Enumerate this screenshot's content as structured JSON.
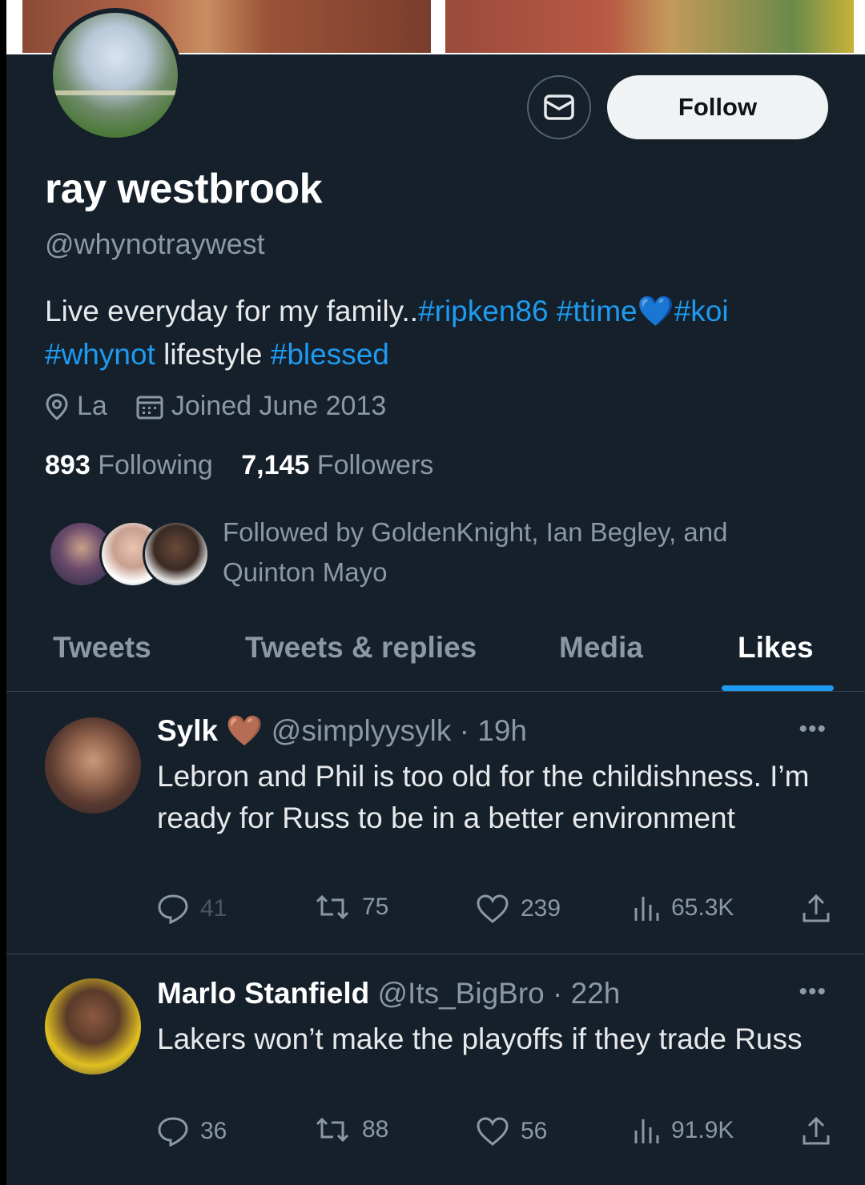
{
  "profile": {
    "name": "ray westbrook",
    "handle": "@whynotraywest",
    "bio_text_1": "Live everyday for my family..",
    "bio_tag_1": "#ripken86",
    "bio_tag_2": "#ttime",
    "bio_emoji": "💙",
    "bio_tag_3": "#koi",
    "bio_tag_4": "#whynot",
    "bio_text_2": "lifestyle",
    "bio_tag_5": "#blessed",
    "location": "La",
    "joined": "Joined June 2013",
    "following_count": "893",
    "following_label": "Following",
    "followers_count": "7,145",
    "followers_label": "Followers",
    "followed_by": "Followed by GoldenKnight, Ian Begley, and Quinton Mayo",
    "follow_label": "Follow"
  },
  "tabs": [
    "Tweets",
    "Tweets & replies",
    "Media",
    "Likes"
  ],
  "active_tab": "Likes",
  "tweets": [
    {
      "name": "Sylk",
      "badge": "🤎",
      "handle": "@simplyysylk",
      "time": "19h",
      "text": "Lebron and Phil is too old for the childishness. I’m ready for Russ to be in a better environment",
      "replies": "41",
      "retweets": "75",
      "likes": "239",
      "views": "65.3K"
    },
    {
      "name": "Marlo Stanfield",
      "handle": "@Its_BigBro",
      "time": "22h",
      "text": "Lakers won’t make the playoffs if they trade Russ",
      "replies": "36",
      "retweets": "88",
      "likes": "56",
      "views": "91.9K"
    }
  ],
  "colors": {
    "background": "#15202b",
    "accent": "#1d9bf0",
    "muted": "#8b98a5",
    "divider": "#38444d"
  }
}
